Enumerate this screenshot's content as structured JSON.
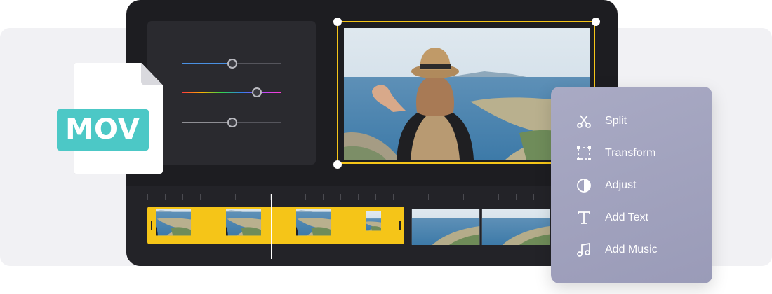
{
  "file_badge": {
    "label": "MOV",
    "color": "#4cc8c6"
  },
  "sliders": [
    {
      "name": "blue-slider",
      "value": 0.5
    },
    {
      "name": "hue-slider",
      "value": 0.75
    },
    {
      "name": "gray-slider",
      "value": 0.5
    }
  ],
  "accent_color": "#f5c518",
  "context_menu": {
    "items": [
      {
        "label": "Split",
        "icon": "scissors-icon"
      },
      {
        "label": "Transform",
        "icon": "transform-icon"
      },
      {
        "label": "Adjust",
        "icon": "adjust-icon"
      },
      {
        "label": "Add Text",
        "icon": "text-icon"
      },
      {
        "label": "Add Music",
        "icon": "music-icon"
      }
    ]
  }
}
